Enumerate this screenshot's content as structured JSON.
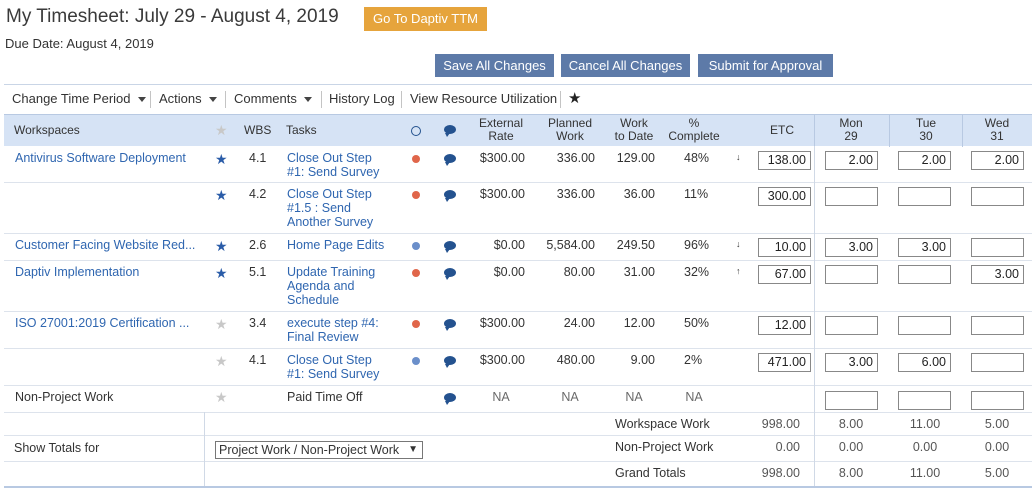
{
  "header": {
    "title": "My Timesheet: July 29 - August 4, 2019",
    "goto_button": "Go To Daptiv TTM",
    "due_date": "Due Date: August 4, 2019"
  },
  "actions": {
    "save": "Save All Changes",
    "cancel": "Cancel All Changes",
    "submit": "Submit for Approval"
  },
  "toolbar": {
    "change_period": "Change Time Period",
    "actions": "Actions",
    "comments": "Comments",
    "history": "History Log",
    "resource": "View Resource Utilization"
  },
  "columns": {
    "workspaces": "Workspaces",
    "wbs": "WBS",
    "tasks": "Tasks",
    "external_rate": [
      "External",
      "Rate"
    ],
    "planned_work": [
      "Planned",
      "Work"
    ],
    "work_to_date": [
      "Work",
      "to Date"
    ],
    "pct_complete": [
      "%",
      "Complete"
    ],
    "etc": "ETC",
    "mon": [
      "Mon",
      "29"
    ],
    "tue": [
      "Tue",
      "30"
    ],
    "wed": [
      "Wed",
      "31"
    ]
  },
  "rows": [
    {
      "workspace": "Antivirus Software Deployment",
      "starred": true,
      "wbs": "4.1",
      "task": "Close Out Step #1: Send Survey",
      "status": "#e0664a",
      "rate": "$300.00",
      "planned": "336.00",
      "todate": "129.00",
      "pct": "48%",
      "trend": "down",
      "etc": "138.00",
      "mon": "2.00",
      "tue": "2.00",
      "wed": "2.00"
    },
    {
      "workspace": "",
      "starred": true,
      "wbs": "4.2",
      "task": "Close Out Step #1.5 : Send Another Survey",
      "status": "#e0664a",
      "rate": "$300.00",
      "planned": "336.00",
      "todate": "36.00",
      "pct": "11%",
      "trend": "",
      "etc": "300.00",
      "mon": "",
      "tue": "",
      "wed": ""
    },
    {
      "workspace": "Customer Facing Website Red...",
      "starred": true,
      "wbs": "2.6",
      "task": "Home Page Edits",
      "status": "#6b8fca",
      "rate": "$0.00",
      "planned": "5,584.00",
      "todate": "249.50",
      "pct": "96%",
      "trend": "down",
      "etc": "10.00",
      "mon": "3.00",
      "tue": "3.00",
      "wed": ""
    },
    {
      "workspace": "Daptiv Implementation",
      "starred": true,
      "wbs": "5.1",
      "task": "Update Training Agenda and Schedule",
      "status": "#e0664a",
      "rate": "$0.00",
      "planned": "80.00",
      "todate": "31.00",
      "pct": "32%",
      "trend": "up",
      "etc": "67.00",
      "mon": "",
      "tue": "",
      "wed": "3.00"
    },
    {
      "workspace": "ISO 27001:2019 Certification ...",
      "starred": false,
      "wbs": "3.4",
      "task": "execute step #4: Final Review",
      "status": "#e0664a",
      "rate": "$300.00",
      "planned": "24.00",
      "todate": "12.00",
      "pct": "50%",
      "trend": "",
      "etc": "12.00",
      "mon": "",
      "tue": "",
      "wed": ""
    },
    {
      "workspace": "",
      "starred": false,
      "wbs": "4.1",
      "task": "Close Out Step #1: Send Survey",
      "status": "#6b8fca",
      "rate": "$300.00",
      "planned": "480.00",
      "todate": "9.00",
      "pct": "2%",
      "trend": "",
      "etc": "471.00",
      "mon": "3.00",
      "tue": "6.00",
      "wed": ""
    }
  ],
  "nonproject": {
    "workspace": "Non-Project Work",
    "task": "Paid Time Off",
    "rate": "NA",
    "planned": "NA",
    "todate": "NA",
    "pct": "NA"
  },
  "totals": {
    "show_totals_label": "Show Totals for",
    "select_value": "Project Work / Non-Project Work",
    "rows": [
      {
        "label": "Workspace Work",
        "etc": "998.00",
        "mon": "8.00",
        "tue": "11.00",
        "wed": "5.00"
      },
      {
        "label": "Non-Project Work",
        "etc": "0.00",
        "mon": "0.00",
        "tue": "0.00",
        "wed": "0.00"
      },
      {
        "label": "Grand Totals",
        "etc": "998.00",
        "mon": "8.00",
        "tue": "11.00",
        "wed": "5.00"
      }
    ]
  },
  "colors": {
    "accent_button": "#5d7aa8",
    "goto_button": "#e6a43c",
    "header_bg": "#d6e3f5",
    "link": "#2f66b0"
  }
}
